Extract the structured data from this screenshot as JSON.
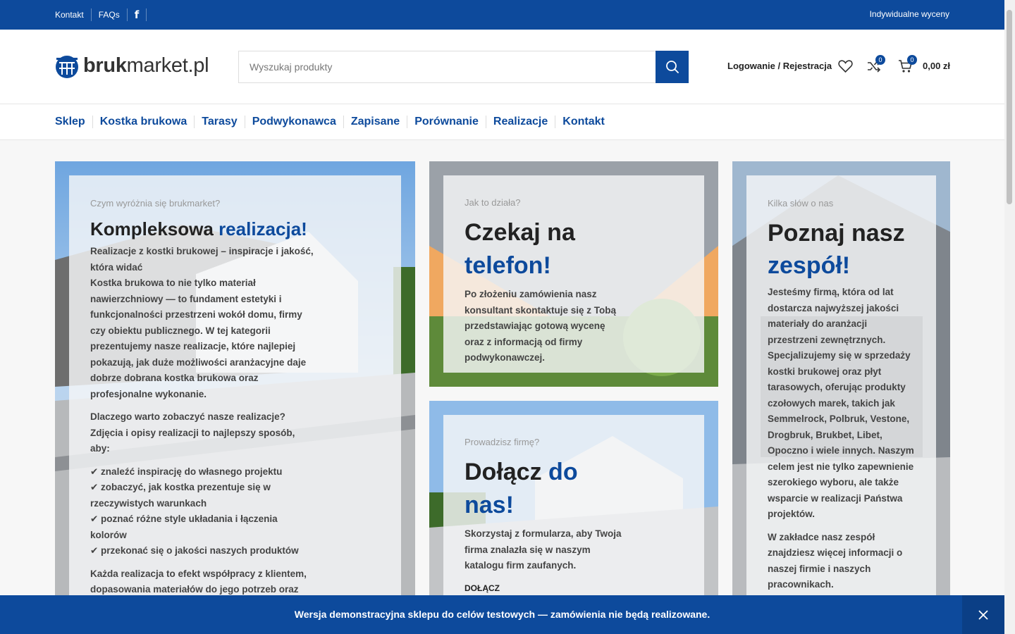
{
  "topbar": {
    "links": [
      "Kontakt",
      "FAQs"
    ],
    "facebook_icon": "f",
    "right_text": "Indywidualne wyceny"
  },
  "header": {
    "logo_bold": "bruk",
    "logo_rest": "market.pl",
    "search_placeholder": "Wyszukaj produkty",
    "account": "Logowanie / Rejestracja",
    "compare_count": "0",
    "cart_count": "0",
    "cart_total": "0,00 zł"
  },
  "nav": [
    "Sklep",
    "Kostka brukowa",
    "Tarasy",
    "Podwykonawca",
    "Zapisane",
    "Porównanie",
    "Realizacje",
    "Kontakt"
  ],
  "cards": {
    "realizacje": {
      "eyebrow": "Czym wyróżnia się brukmarket?",
      "title_1": "Kompleksowa ",
      "title_2": "realizacja!",
      "p1_line1": "Realizacje z kostki brukowej – inspiracje i jakość, która widać",
      "p1_rest": "Kostka brukowa to nie tylko materiał nawierzchniowy — to fundament estetyki i funkcjonalności przestrzeni wokół domu, firmy czy obiektu publicznego. W tej kategorii prezentujemy nasze realizacje, które najlepiej pokazują, jak duże możliwości aranżacyjne daje dobrze dobrana kostka brukowa oraz profesjonalne wykonanie.",
      "p2": "Dlaczego warto zobaczyć nasze realizacje?",
      "p2b": "Zdjęcia i opisy realizacji to najlepszy sposób, aby:",
      "bullets": [
        "✔ znaleźć inspirację do własnego projektu",
        "✔ zobaczyć, jak kostka prezentuje się w rzeczywistych warunkach",
        "✔ poznać różne style układania i łączenia kolorów",
        "✔ przekonać się o jakości naszych produktów"
      ],
      "p3": "Każda realizacja to efekt współpracy z klientem, dopasowania materiałów do jego potrzeb oraz starannego wykonania."
    },
    "telefon": {
      "eyebrow": "Jak to działa?",
      "title_1": "Czekaj na ",
      "title_2": "telefon!",
      "text": "Po złożeniu zamówienia nasz konsultant skontaktuje się z Tobą przedstawiając gotową wycenę oraz z informacją od firmy podwykonawczej."
    },
    "dolacz": {
      "eyebrow": "Prowadzisz firmę?",
      "title_1": "Dołącz ",
      "title_2": "do nas!",
      "text": "Skorzystaj z formularza, aby Twoja firma znalazła się w naszym katalogu firm zaufanych.",
      "link": "DOŁĄCZ"
    },
    "zespol": {
      "eyebrow": "Kilka słów o nas",
      "title_1": "Poznaj nasz ",
      "title_2": "zespół!",
      "p1": "Jesteśmy firmą, która od lat dostarcza najwyższej jakości materiały do aranżacji przestrzeni zewnętrznych. Specjalizujemy się w sprzedaży kostki brukowej oraz płyt tarasowych, oferując produkty czołowych marek, takich jak Semmelrock, Polbruk, Vestone, Drogbruk, Brukbet, Libet, Opoczno i wiele innych. Naszym celem jest nie tylko zapewnienie szerokiego wyboru, ale także wsparcie w realizacji Państwa projektów.",
      "p2": "W zakładce nasz zespół znajdziesz więcej informacji o naszej firmie i naszych pracownikach."
    }
  },
  "demo_notice": "Wersja demonstracyjna sklepu do celów testowych — zamówienia nie będą realizowane.",
  "colors": {
    "brand": "#0d4a9c"
  }
}
